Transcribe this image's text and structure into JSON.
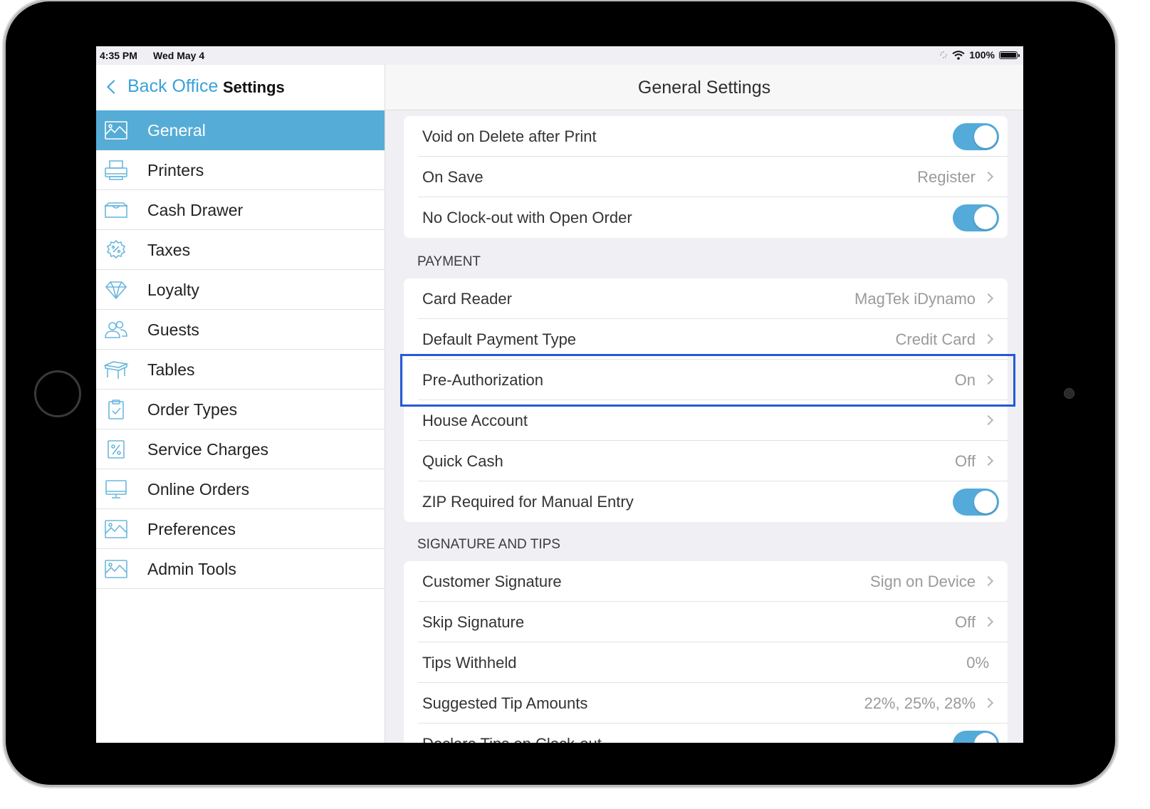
{
  "status_bar": {
    "time": "4:35 PM",
    "date": "Wed May 4",
    "battery": "100%"
  },
  "sidebar": {
    "back_label": "Back Office",
    "title": "Settings",
    "items": [
      {
        "label": "General",
        "icon": "general-icon",
        "active": true
      },
      {
        "label": "Printers",
        "icon": "printer-icon"
      },
      {
        "label": "Cash Drawer",
        "icon": "cash-drawer-icon"
      },
      {
        "label": "Taxes",
        "icon": "taxes-icon"
      },
      {
        "label": "Loyalty",
        "icon": "diamond-icon"
      },
      {
        "label": "Guests",
        "icon": "guests-icon"
      },
      {
        "label": "Tables",
        "icon": "table-icon"
      },
      {
        "label": "Order Types",
        "icon": "clipboard-icon"
      },
      {
        "label": "Service Charges",
        "icon": "percent-icon"
      },
      {
        "label": "Online Orders",
        "icon": "monitor-icon"
      },
      {
        "label": "Preferences",
        "icon": "preferences-icon"
      },
      {
        "label": "Admin Tools",
        "icon": "admin-tools-icon"
      }
    ]
  },
  "content": {
    "title": "General Settings",
    "group1": [
      {
        "label": "Void on Delete after Print",
        "toggle": true
      },
      {
        "label": "On Save",
        "value": "Register"
      },
      {
        "label": "No Clock-out with Open Order",
        "toggle": true
      }
    ],
    "payment_header": "PAYMENT",
    "payment": [
      {
        "label": "Card Reader",
        "value": "MagTek iDynamo"
      },
      {
        "label": "Default Payment Type",
        "value": "Credit Card"
      },
      {
        "label": "Pre-Authorization",
        "value": "On"
      },
      {
        "label": "House Account",
        "value": ""
      },
      {
        "label": "Quick Cash",
        "value": "Off"
      },
      {
        "label": "ZIP Required for Manual Entry",
        "toggle": true
      }
    ],
    "signature_header": "SIGNATURE AND TIPS",
    "signature": [
      {
        "label": "Customer Signature",
        "value": "Sign on Device"
      },
      {
        "label": "Skip Signature",
        "value": "Off"
      },
      {
        "label": "Tips Withheld",
        "value": "0%"
      },
      {
        "label": "Suggested Tip Amounts",
        "value": "22%, 25%, 28%"
      },
      {
        "label": "Declare Tips on Clock-out",
        "toggle": true
      }
    ]
  },
  "colors": {
    "accent": "#55acd6",
    "toggle_on": "#54abd9",
    "highlight_border": "#2559d6"
  }
}
